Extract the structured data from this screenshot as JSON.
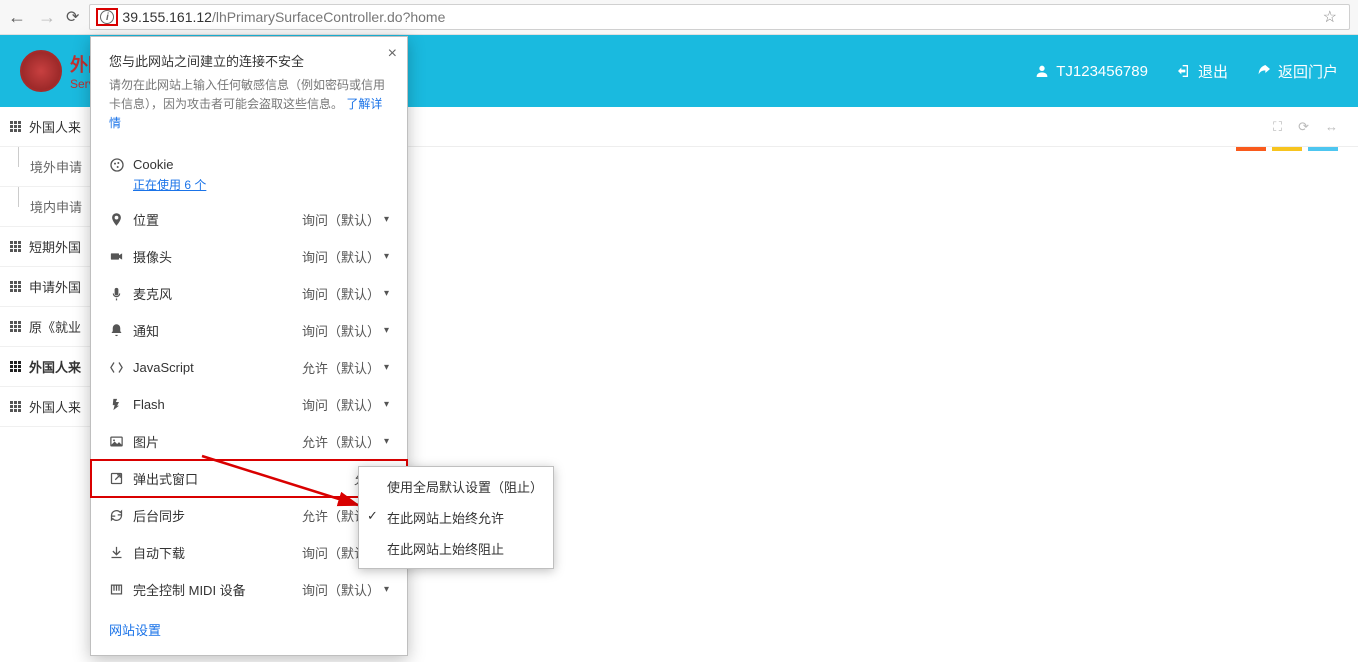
{
  "browser": {
    "url_host": "39.155.161.12",
    "url_path": "/lhPrimarySurfaceController.do?home"
  },
  "app": {
    "logo_cn": "外国",
    "logo_en": "Service",
    "user_id": "TJ123456789",
    "logout": "退出",
    "back_portal": "返回门户"
  },
  "sidebar": {
    "items": [
      {
        "label": "外国人来",
        "type": "main"
      },
      {
        "label": "境外申请",
        "type": "sub"
      },
      {
        "label": "境内申请",
        "type": "sub"
      },
      {
        "label": "短期外国",
        "type": "main"
      },
      {
        "label": "申请外国",
        "type": "main"
      },
      {
        "label": "原《就业",
        "type": "main"
      },
      {
        "label": "外国人来",
        "type": "bold"
      },
      {
        "label": "外国人来",
        "type": "main"
      }
    ]
  },
  "security": {
    "title": "您与此网站之间建立的连接不安全",
    "desc_a": "请勿在此网站上输入任何敏感信息（例如密码或信用卡信息），因为攻击者可能会盗取这些信息。",
    "learn_more": "了解详情",
    "cookie_label": "Cookie",
    "cookie_usage": "正在使用 6 个",
    "perms": [
      {
        "icon": "location",
        "label": "位置",
        "value": "询问（默认）"
      },
      {
        "icon": "camera",
        "label": "摄像头",
        "value": "询问（默认）"
      },
      {
        "icon": "mic",
        "label": "麦克风",
        "value": "询问（默认）"
      },
      {
        "icon": "bell",
        "label": "通知",
        "value": "询问（默认）"
      },
      {
        "icon": "js",
        "label": "JavaScript",
        "value": "允许（默认）"
      },
      {
        "icon": "flash",
        "label": "Flash",
        "value": "询问（默认）"
      },
      {
        "icon": "image",
        "label": "图片",
        "value": "允许（默认）"
      },
      {
        "icon": "popup",
        "label": "弹出式窗口",
        "value": "允许",
        "hl": true
      },
      {
        "icon": "sync",
        "label": "后台同步",
        "value": "允许（默认）"
      },
      {
        "icon": "download",
        "label": "自动下载",
        "value": "询问（默认）"
      },
      {
        "icon": "midi",
        "label": "完全控制 MIDI 设备",
        "value": "询问（默认）"
      }
    ],
    "site_settings": "网站设置"
  },
  "submenu": {
    "options": [
      {
        "label": "使用全局默认设置（阻止）",
        "sel": false
      },
      {
        "label": "在此网站上始终允许",
        "sel": true
      },
      {
        "label": "在此网站上始终阻止",
        "sel": false
      }
    ]
  },
  "colors": {
    "strip1": "#f95a1c",
    "strip2": "#f7c41f",
    "strip3": "#4dc6f0"
  }
}
